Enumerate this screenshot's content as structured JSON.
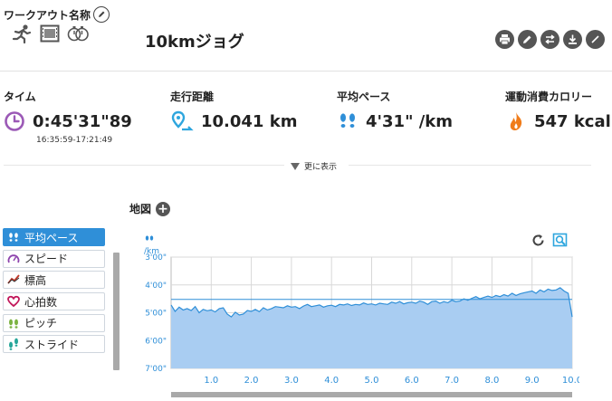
{
  "header": {
    "workout_name_label": "ワークアウト名称",
    "workout_title": "10kmジョグ"
  },
  "stats": {
    "time": {
      "label": "タイム",
      "value": "0:45'31\"89",
      "range": "16:35:59-17:21:49",
      "icon_color": "#9b59b6"
    },
    "distance": {
      "label": "走行距離",
      "value": "10.041 km",
      "icon_color": "#2ea6de"
    },
    "pace": {
      "label": "平均ペース",
      "value": "4'31\" /km",
      "icon_color": "#2f8fd8"
    },
    "calories": {
      "label": "運動消費カロリー",
      "value": "547 kcal",
      "icon_color": "#f07c1a"
    }
  },
  "more_toggle": "更に表示",
  "map": {
    "title": "地図"
  },
  "metric_menu": [
    {
      "label": "平均ペース",
      "icon": "footsteps-icon",
      "icon_color": "#ffffff",
      "active": true
    },
    {
      "label": "スピード",
      "icon": "speedometer-icon",
      "icon_color": "#8e44ad",
      "active": false
    },
    {
      "label": "標高",
      "icon": "elevation-icon",
      "icon_color": "#c0392b",
      "active": false
    },
    {
      "label": "心拍数",
      "icon": "heart-icon",
      "icon_color": "#c2185b",
      "active": false
    },
    {
      "label": "ピッチ",
      "icon": "pitch-icon",
      "icon_color": "#7cb342",
      "active": false
    },
    {
      "label": "ストライド",
      "icon": "stride-icon",
      "icon_color": "#26a69a",
      "active": false
    }
  ],
  "chart_data": {
    "type": "area",
    "ylabel": "/km",
    "y_ticks": [
      "3'00\"",
      "4'00\"",
      "5'00\"",
      "6'00\"",
      "7'00\""
    ],
    "y_tick_values": [
      3,
      4,
      5,
      6,
      7
    ],
    "ylim": [
      3,
      7
    ],
    "y_inverted": true,
    "x_ticks": [
      "1.0",
      "2.0",
      "3.0",
      "4.0",
      "5.0",
      "6.0",
      "7.0",
      "8.0",
      "9.0",
      "10.0"
    ],
    "xlim": [
      0.0,
      10.0
    ],
    "grid": true,
    "fill_color": "#a9cdf2",
    "line_color": "#2f8fd8",
    "reference_value": 4.52,
    "x": [
      0.0,
      0.1,
      0.2,
      0.3,
      0.4,
      0.5,
      0.6,
      0.7,
      0.8,
      0.9,
      1.0,
      1.1,
      1.2,
      1.3,
      1.4,
      1.5,
      1.6,
      1.7,
      1.8,
      1.9,
      2.0,
      2.1,
      2.2,
      2.3,
      2.4,
      2.5,
      2.6,
      2.7,
      2.8,
      2.9,
      3.0,
      3.1,
      3.2,
      3.3,
      3.4,
      3.5,
      3.6,
      3.7,
      3.8,
      3.9,
      4.0,
      4.1,
      4.2,
      4.3,
      4.4,
      4.5,
      4.6,
      4.7,
      4.8,
      4.9,
      5.0,
      5.1,
      5.2,
      5.3,
      5.4,
      5.5,
      5.6,
      5.7,
      5.8,
      5.9,
      6.0,
      6.1,
      6.2,
      6.3,
      6.4,
      6.5,
      6.6,
      6.7,
      6.8,
      6.9,
      7.0,
      7.1,
      7.2,
      7.3,
      7.4,
      7.5,
      7.6,
      7.7,
      7.8,
      7.9,
      8.0,
      8.1,
      8.2,
      8.3,
      8.4,
      8.5,
      8.6,
      8.7,
      8.8,
      8.9,
      9.0,
      9.1,
      9.2,
      9.3,
      9.4,
      9.5,
      9.6,
      9.7,
      9.8,
      9.9,
      10.0
    ],
    "values": [
      4.72,
      4.95,
      4.8,
      4.9,
      4.85,
      4.92,
      4.78,
      5.0,
      4.88,
      4.93,
      4.9,
      4.97,
      4.85,
      4.82,
      5.05,
      5.15,
      4.98,
      5.08,
      5.05,
      4.92,
      4.95,
      4.88,
      4.96,
      4.82,
      4.9,
      4.85,
      4.78,
      4.8,
      4.82,
      4.75,
      4.8,
      4.78,
      4.85,
      4.76,
      4.7,
      4.78,
      4.75,
      4.72,
      4.8,
      4.75,
      4.73,
      4.78,
      4.7,
      4.72,
      4.68,
      4.74,
      4.7,
      4.72,
      4.65,
      4.7,
      4.68,
      4.72,
      4.66,
      4.68,
      4.7,
      4.62,
      4.66,
      4.6,
      4.68,
      4.64,
      4.62,
      4.66,
      4.58,
      4.62,
      4.7,
      4.6,
      4.58,
      4.66,
      4.6,
      4.64,
      4.55,
      4.6,
      4.58,
      4.5,
      4.55,
      4.48,
      4.42,
      4.5,
      4.45,
      4.4,
      4.45,
      4.38,
      4.42,
      4.35,
      4.4,
      4.3,
      4.38,
      4.32,
      4.28,
      4.25,
      4.22,
      4.3,
      4.18,
      4.25,
      4.15,
      4.2,
      4.18,
      4.1,
      4.22,
      4.3,
      5.15
    ]
  }
}
